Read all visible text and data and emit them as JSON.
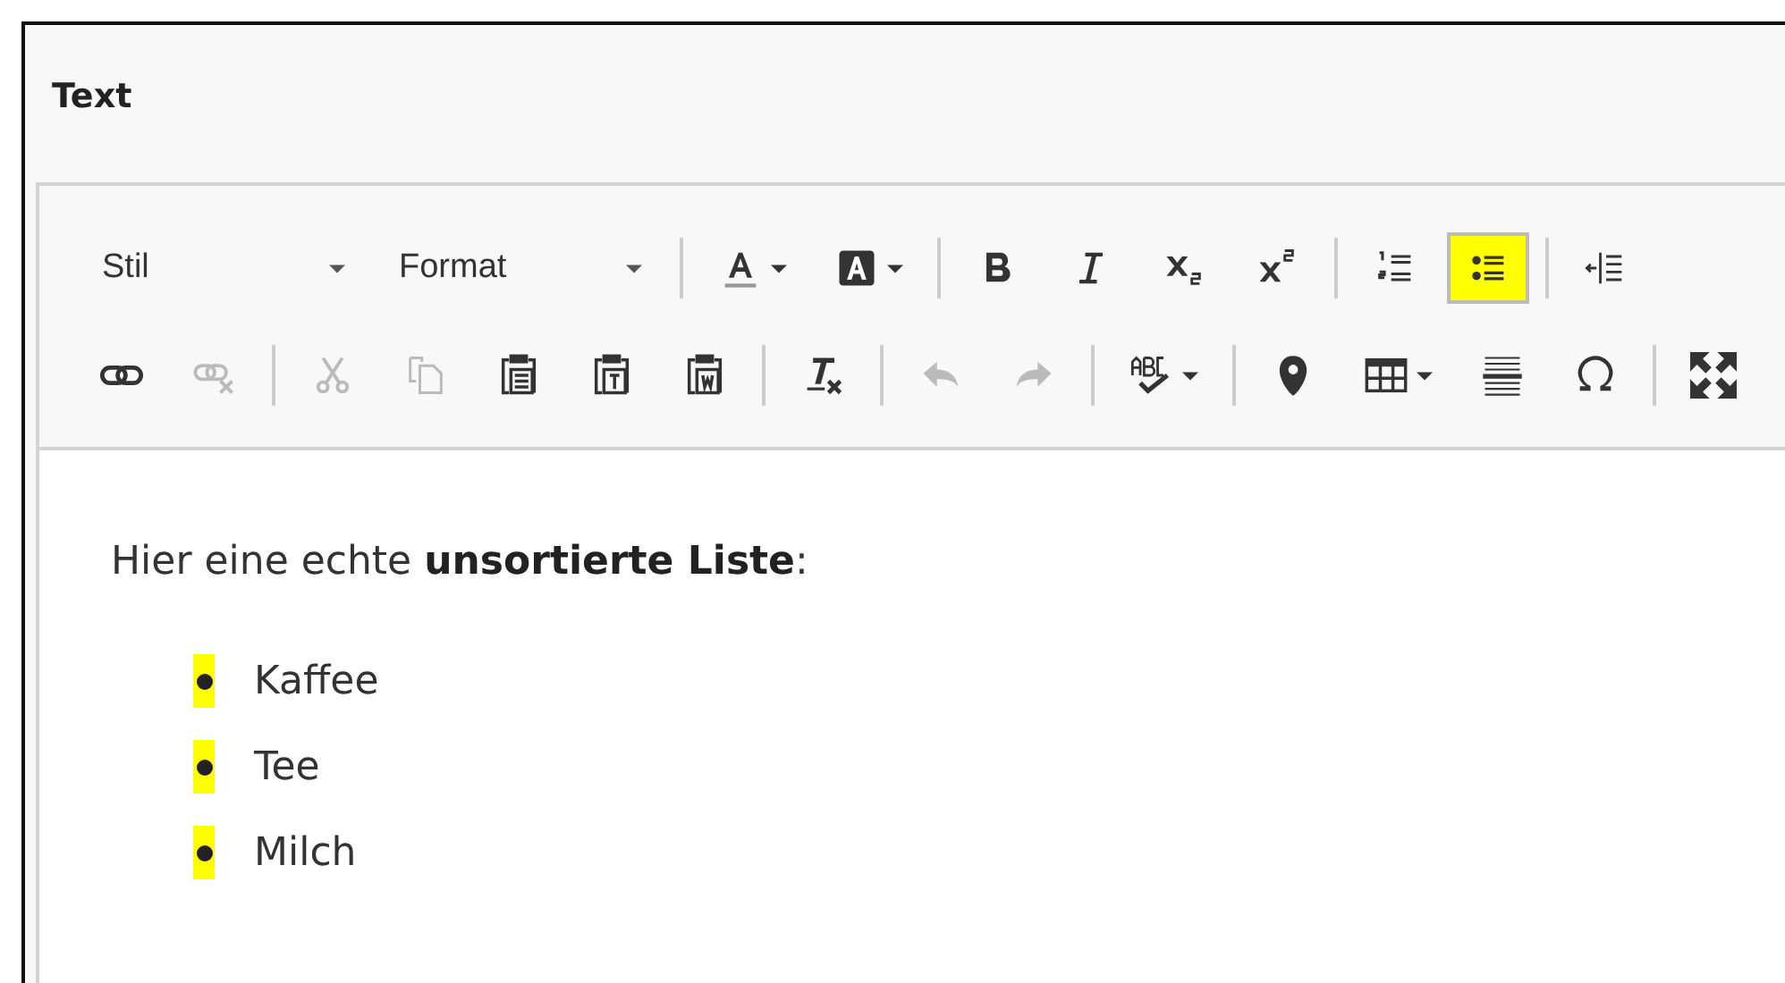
{
  "field_label": "Text",
  "toolbar": {
    "rows": [
      [
        [
          {
            "kind": "dropdown",
            "label": "Stil"
          },
          {
            "kind": "dropdown",
            "label": "Format"
          }
        ],
        [
          {
            "kind": "text-color",
            "dropdown": true
          },
          {
            "kind": "bg-color",
            "dropdown": true
          }
        ],
        [
          {
            "kind": "bold"
          },
          {
            "kind": "italic"
          },
          {
            "kind": "subscript"
          },
          {
            "kind": "superscript"
          }
        ],
        [
          {
            "kind": "numbered-list",
            "active": false
          },
          {
            "kind": "bulleted-list",
            "active": true,
            "highlighted": true
          }
        ],
        [
          {
            "kind": "outdent"
          }
        ]
      ],
      [
        [
          {
            "kind": "link"
          },
          {
            "kind": "unlink",
            "disabled": true
          }
        ],
        [
          {
            "kind": "cut",
            "disabled": true
          },
          {
            "kind": "copy",
            "disabled": true
          },
          {
            "kind": "paste"
          },
          {
            "kind": "paste-text"
          },
          {
            "kind": "paste-word"
          }
        ],
        [
          {
            "kind": "remove-format"
          }
        ],
        [
          {
            "kind": "undo",
            "disabled": true
          },
          {
            "kind": "redo",
            "disabled": true
          }
        ],
        [
          {
            "kind": "spellcheck",
            "dropdown": true
          }
        ],
        [
          {
            "kind": "map-pin"
          },
          {
            "kind": "table",
            "dropdown": true
          },
          {
            "kind": "horizontal-rule"
          },
          {
            "kind": "special-char"
          }
        ],
        [
          {
            "kind": "maximize"
          }
        ]
      ]
    ]
  },
  "content": {
    "paragraph": "Hier eine echte **unsortierte Liste**:",
    "list": [
      {
        "text": "Kaffee",
        "highlighted": true
      },
      {
        "text": "Tee",
        "highlighted": true
      },
      {
        "text": "Milch",
        "highlighted": true
      }
    ]
  }
}
